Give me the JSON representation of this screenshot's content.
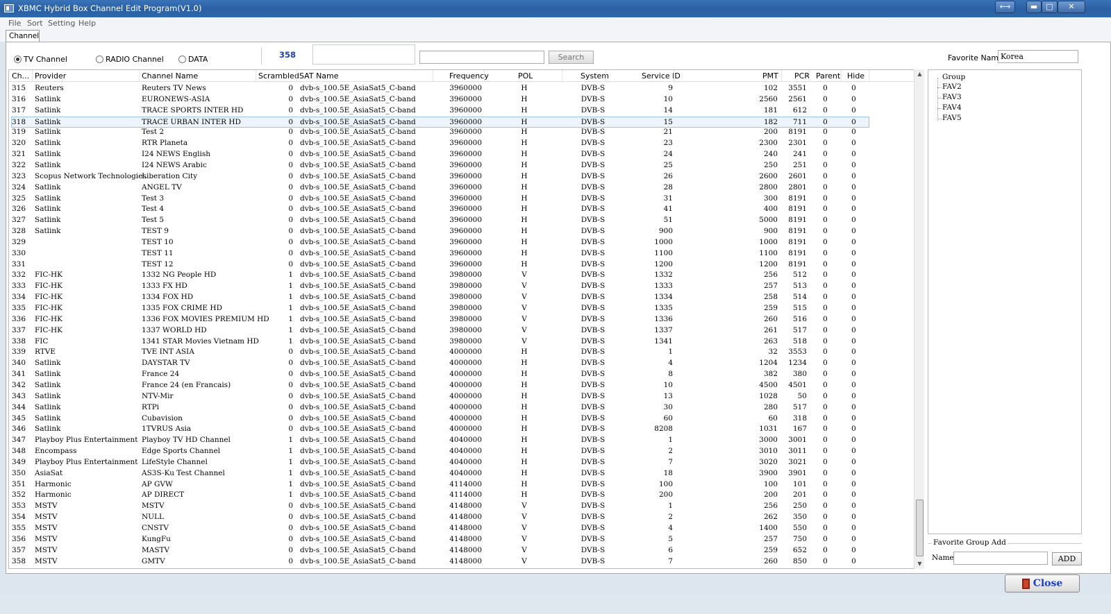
{
  "window": {
    "title": "XBMC Hybrid Box Channel Edit Program(V1.0)",
    "restore_glyph": "⟷",
    "min_glyph": "▬",
    "max_glyph": "□",
    "close_glyph": "✕"
  },
  "menu": [
    "File",
    "Sort",
    "Setting",
    "Help"
  ],
  "tab": {
    "label": "Channel"
  },
  "filters": {
    "tv": "TV Channel",
    "radio": "RADIO Channel",
    "data": "DATA",
    "selected": "tv"
  },
  "channel_count": "358",
  "search": {
    "button": "Search",
    "value": ""
  },
  "favorite": {
    "label": "Favorite  Name",
    "value": "Korea"
  },
  "table": {
    "headers": [
      "Ch...",
      "Provider",
      "Channel Name",
      "Scrambled",
      "SAT Name",
      "Frequency",
      "POL",
      "System",
      "Service ID",
      "PMT",
      "PCR",
      "Parent",
      "Hide"
    ],
    "selected_row": 3,
    "rows": [
      [
        "315",
        "Reuters",
        "Reuters TV News",
        "0",
        "dvb-s_100.5E_AsiaSat5_C-band",
        "3960000",
        "H",
        "DVB-S",
        "9",
        "102",
        "3551",
        "0",
        "0"
      ],
      [
        "316",
        "Satlink",
        "EURONEWS-ASIA",
        "0",
        "dvb-s_100.5E_AsiaSat5_C-band",
        "3960000",
        "H",
        "DVB-S",
        "10",
        "2560",
        "2561",
        "0",
        "0"
      ],
      [
        "317",
        "Satlink",
        "TRACE SPORTS INTER HD",
        "0",
        "dvb-s_100.5E_AsiaSat5_C-band",
        "3960000",
        "H",
        "DVB-S",
        "14",
        "181",
        "612",
        "0",
        "0"
      ],
      [
        "318",
        "Satlink",
        "TRACE URBAN INTER HD",
        "0",
        "dvb-s_100.5E_AsiaSat5_C-band",
        "3960000",
        "H",
        "DVB-S",
        "15",
        "182",
        "711",
        "0",
        "0"
      ],
      [
        "319",
        "Satlink",
        "Test 2",
        "0",
        "dvb-s_100.5E_AsiaSat5_C-band",
        "3960000",
        "H",
        "DVB-S",
        "21",
        "200",
        "8191",
        "0",
        "0"
      ],
      [
        "320",
        "Satlink",
        "RTR Planeta",
        "0",
        "dvb-s_100.5E_AsiaSat5_C-band",
        "3960000",
        "H",
        "DVB-S",
        "23",
        "2300",
        "2301",
        "0",
        "0"
      ],
      [
        "321",
        "Satlink",
        "I24 NEWS English",
        "0",
        "dvb-s_100.5E_AsiaSat5_C-band",
        "3960000",
        "H",
        "DVB-S",
        "24",
        "240",
        "241",
        "0",
        "0"
      ],
      [
        "322",
        "Satlink",
        "I24 NEWS Arabic",
        "0",
        "dvb-s_100.5E_AsiaSat5_C-band",
        "3960000",
        "H",
        "DVB-S",
        "25",
        "250",
        "251",
        "0",
        "0"
      ],
      [
        "323",
        "Scopus Network Technologies",
        "Liberation City",
        "0",
        "dvb-s_100.5E_AsiaSat5_C-band",
        "3960000",
        "H",
        "DVB-S",
        "26",
        "2600",
        "2601",
        "0",
        "0"
      ],
      [
        "324",
        "Satlink",
        "ANGEL TV",
        "0",
        "dvb-s_100.5E_AsiaSat5_C-band",
        "3960000",
        "H",
        "DVB-S",
        "28",
        "2800",
        "2801",
        "0",
        "0"
      ],
      [
        "325",
        "Satlink",
        "Test 3",
        "0",
        "dvb-s_100.5E_AsiaSat5_C-band",
        "3960000",
        "H",
        "DVB-S",
        "31",
        "300",
        "8191",
        "0",
        "0"
      ],
      [
        "326",
        "Satlink",
        "Test 4",
        "0",
        "dvb-s_100.5E_AsiaSat5_C-band",
        "3960000",
        "H",
        "DVB-S",
        "41",
        "400",
        "8191",
        "0",
        "0"
      ],
      [
        "327",
        "Satlink",
        "Test 5",
        "0",
        "dvb-s_100.5E_AsiaSat5_C-band",
        "3960000",
        "H",
        "DVB-S",
        "51",
        "5000",
        "8191",
        "0",
        "0"
      ],
      [
        "328",
        "Satlink",
        "TEST 9",
        "0",
        "dvb-s_100.5E_AsiaSat5_C-band",
        "3960000",
        "H",
        "DVB-S",
        "900",
        "900",
        "8191",
        "0",
        "0"
      ],
      [
        "329",
        "",
        "TEST 10",
        "0",
        "dvb-s_100.5E_AsiaSat5_C-band",
        "3960000",
        "H",
        "DVB-S",
        "1000",
        "1000",
        "8191",
        "0",
        "0"
      ],
      [
        "330",
        "",
        "TEST 11",
        "0",
        "dvb-s_100.5E_AsiaSat5_C-band",
        "3960000",
        "H",
        "DVB-S",
        "1100",
        "1100",
        "8191",
        "0",
        "0"
      ],
      [
        "331",
        "",
        "TEST 12",
        "0",
        "dvb-s_100.5E_AsiaSat5_C-band",
        "3960000",
        "H",
        "DVB-S",
        "1200",
        "1200",
        "8191",
        "0",
        "0"
      ],
      [
        "332",
        "FIC-HK",
        "1332 NG People HD",
        "1",
        "dvb-s_100.5E_AsiaSat5_C-band",
        "3980000",
        "V",
        "DVB-S",
        "1332",
        "256",
        "512",
        "0",
        "0"
      ],
      [
        "333",
        "FIC-HK",
        "1333 FX HD",
        "1",
        "dvb-s_100.5E_AsiaSat5_C-band",
        "3980000",
        "V",
        "DVB-S",
        "1333",
        "257",
        "513",
        "0",
        "0"
      ],
      [
        "334",
        "FIC-HK",
        "1334 FOX HD",
        "1",
        "dvb-s_100.5E_AsiaSat5_C-band",
        "3980000",
        "V",
        "DVB-S",
        "1334",
        "258",
        "514",
        "0",
        "0"
      ],
      [
        "335",
        "FIC-HK",
        "1335 FOX CRIME HD",
        "1",
        "dvb-s_100.5E_AsiaSat5_C-band",
        "3980000",
        "V",
        "DVB-S",
        "1335",
        "259",
        "515",
        "0",
        "0"
      ],
      [
        "336",
        "FIC-HK",
        "1336 FOX MOVIES PREMIUM HD",
        "1",
        "dvb-s_100.5E_AsiaSat5_C-band",
        "3980000",
        "V",
        "DVB-S",
        "1336",
        "260",
        "516",
        "0",
        "0"
      ],
      [
        "337",
        "FIC-HK",
        "1337 WORLD HD",
        "1",
        "dvb-s_100.5E_AsiaSat5_C-band",
        "3980000",
        "V",
        "DVB-S",
        "1337",
        "261",
        "517",
        "0",
        "0"
      ],
      [
        "338",
        "FIC",
        "1341 STAR Movies Vietnam HD",
        "1",
        "dvb-s_100.5E_AsiaSat5_C-band",
        "3980000",
        "V",
        "DVB-S",
        "1341",
        "263",
        "518",
        "0",
        "0"
      ],
      [
        "339",
        "RTVE",
        "TVE INT ASIA",
        "0",
        "dvb-s_100.5E_AsiaSat5_C-band",
        "4000000",
        "H",
        "DVB-S",
        "1",
        "32",
        "3553",
        "0",
        "0"
      ],
      [
        "340",
        "Satlink",
        "DAYSTAR TV",
        "0",
        "dvb-s_100.5E_AsiaSat5_C-band",
        "4000000",
        "H",
        "DVB-S",
        "4",
        "1204",
        "1234",
        "0",
        "0"
      ],
      [
        "341",
        "Satlink",
        "France 24",
        "0",
        "dvb-s_100.5E_AsiaSat5_C-band",
        "4000000",
        "H",
        "DVB-S",
        "8",
        "382",
        "380",
        "0",
        "0"
      ],
      [
        "342",
        "Satlink",
        "France 24 (en Francais)",
        "0",
        "dvb-s_100.5E_AsiaSat5_C-band",
        "4000000",
        "H",
        "DVB-S",
        "10",
        "4500",
        "4501",
        "0",
        "0"
      ],
      [
        "343",
        "Satlink",
        "NTV-Mir",
        "0",
        "dvb-s_100.5E_AsiaSat5_C-band",
        "4000000",
        "H",
        "DVB-S",
        "13",
        "1028",
        "50",
        "0",
        "0"
      ],
      [
        "344",
        "Satlink",
        "RTPi",
        "0",
        "dvb-s_100.5E_AsiaSat5_C-band",
        "4000000",
        "H",
        "DVB-S",
        "30",
        "280",
        "517",
        "0",
        "0"
      ],
      [
        "345",
        "Satlink",
        "Cubavision",
        "0",
        "dvb-s_100.5E_AsiaSat5_C-band",
        "4000000",
        "H",
        "DVB-S",
        "60",
        "60",
        "318",
        "0",
        "0"
      ],
      [
        "346",
        "Satlink",
        "1TVRUS Asia",
        "0",
        "dvb-s_100.5E_AsiaSat5_C-band",
        "4000000",
        "H",
        "DVB-S",
        "8208",
        "1031",
        "167",
        "0",
        "0"
      ],
      [
        "347",
        "Playboy Plus Entertainment",
        "Playboy TV HD Channel",
        "1",
        "dvb-s_100.5E_AsiaSat5_C-band",
        "4040000",
        "H",
        "DVB-S",
        "1",
        "3000",
        "3001",
        "0",
        "0"
      ],
      [
        "348",
        "Encompass",
        "Edge Sports Channel",
        "1",
        "dvb-s_100.5E_AsiaSat5_C-band",
        "4040000",
        "H",
        "DVB-S",
        "2",
        "3010",
        "3011",
        "0",
        "0"
      ],
      [
        "349",
        "Playboy Plus Entertainment",
        "LifeStyle Channel",
        "1",
        "dvb-s_100.5E_AsiaSat5_C-band",
        "4040000",
        "H",
        "DVB-S",
        "7",
        "3020",
        "3021",
        "0",
        "0"
      ],
      [
        "350",
        "AsiaSat",
        "AS3S-Ku Test Channel",
        "1",
        "dvb-s_100.5E_AsiaSat5_C-band",
        "4040000",
        "H",
        "DVB-S",
        "18",
        "3900",
        "3901",
        "0",
        "0"
      ],
      [
        "351",
        "Harmonic",
        "AP GVW",
        "1",
        "dvb-s_100.5E_AsiaSat5_C-band",
        "4114000",
        "H",
        "DVB-S",
        "100",
        "100",
        "101",
        "0",
        "0"
      ],
      [
        "352",
        "Harmonic",
        "AP DIRECT",
        "1",
        "dvb-s_100.5E_AsiaSat5_C-band",
        "4114000",
        "H",
        "DVB-S",
        "200",
        "200",
        "201",
        "0",
        "0"
      ],
      [
        "353",
        "MSTV",
        "MSTV",
        "0",
        "dvb-s_100.5E_AsiaSat5_C-band",
        "4148000",
        "V",
        "DVB-S",
        "1",
        "256",
        "250",
        "0",
        "0"
      ],
      [
        "354",
        "MSTV",
        "NULL",
        "0",
        "dvb-s_100.5E_AsiaSat5_C-band",
        "4148000",
        "V",
        "DVB-S",
        "2",
        "262",
        "350",
        "0",
        "0"
      ],
      [
        "355",
        "MSTV",
        "CNSTV",
        "0",
        "dvb-s_100.5E_AsiaSat5_C-band",
        "4148000",
        "V",
        "DVB-S",
        "4",
        "1400",
        "550",
        "0",
        "0"
      ],
      [
        "356",
        "MSTV",
        "KungFu",
        "0",
        "dvb-s_100.5E_AsiaSat5_C-band",
        "4148000",
        "V",
        "DVB-S",
        "5",
        "257",
        "750",
        "0",
        "0"
      ],
      [
        "357",
        "MSTV",
        "MASTV",
        "0",
        "dvb-s_100.5E_AsiaSat5_C-band",
        "4148000",
        "V",
        "DVB-S",
        "6",
        "259",
        "652",
        "0",
        "0"
      ],
      [
        "358",
        "MSTV",
        "GMTV",
        "0",
        "dvb-s_100.5E_AsiaSat5_C-band",
        "4148000",
        "V",
        "DVB-S",
        "7",
        "260",
        "850",
        "0",
        "0"
      ]
    ]
  },
  "groups": {
    "root": "Group",
    "items": [
      "FAV2",
      "FAV3",
      "FAV4",
      "FAV5"
    ]
  },
  "favorite_group_add": {
    "legend": "Favorite Group Add",
    "name_label": "Name",
    "add_button": "ADD",
    "name_value": ""
  },
  "close_button": "Close"
}
